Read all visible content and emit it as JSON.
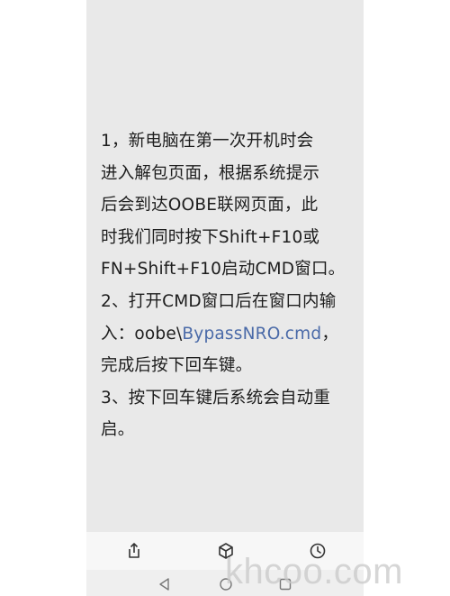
{
  "article": {
    "lines": [
      "1，新电脑在第一次开机时会",
      "进入解包页面，根据系统提示",
      "后会到达OOBE联网页面，此",
      "时我们同时按下Shift+F10或",
      "FN+Shift+F10启动CMD窗口。",
      "2、打开CMD窗口后在窗口内输"
    ],
    "line7_prefix": "入：oobe\\",
    "line7_link": "BypassNRO.cmd",
    "line7_suffix": "，",
    "lines_after": [
      "完成后按下回车键。",
      "3、按下回车键后系统会自动重",
      "启。"
    ]
  },
  "toolbar": {
    "icons": [
      "share-icon",
      "cube-icon",
      "clock-icon"
    ]
  },
  "navbar": {
    "icons": [
      "back-triangle-icon",
      "home-circle-icon",
      "recents-square-icon"
    ]
  },
  "watermark": "khcoo.com",
  "colors": {
    "text": "#1d1d1d",
    "link": "#4a6aa8",
    "content_bg": "#e9e9e9"
  }
}
